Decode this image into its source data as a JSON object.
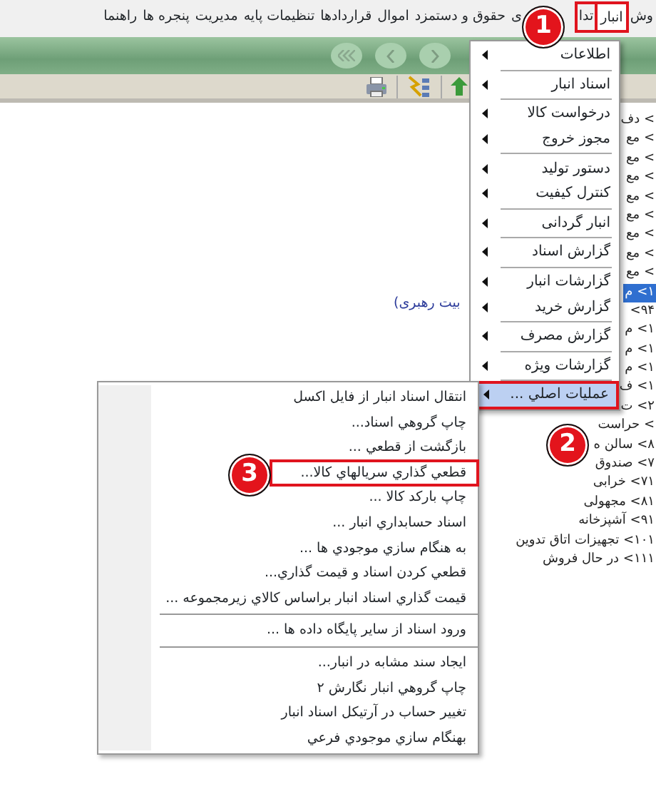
{
  "menu_bar": [
    {
      "label": "وش",
      "selected": false,
      "boxed": false
    },
    {
      "label": "انبار",
      "selected": true,
      "boxed": true
    },
    {
      "label": "تدا",
      "selected": false,
      "boxed": true
    },
    {
      "label": "ی",
      "selected": false,
      "boxed": false
    },
    {
      "label": "حقوق و دستمزد",
      "selected": false,
      "boxed": false
    },
    {
      "label": "اموال",
      "selected": false,
      "boxed": false
    },
    {
      "label": "قراردادها",
      "selected": false,
      "boxed": false
    },
    {
      "label": "تنظیمات پایه",
      "selected": false,
      "boxed": false
    },
    {
      "label": "مدیریت",
      "selected": false,
      "boxed": false
    },
    {
      "label": "پنجره ها",
      "selected": false,
      "boxed": false
    },
    {
      "label": "راهنما",
      "selected": false,
      "boxed": false
    }
  ],
  "tree": [
    {
      "label": "> دف",
      "selected": false
    },
    {
      "label": "> مع",
      "selected": false
    },
    {
      "label": "> مع",
      "selected": false
    },
    {
      "label": "> مع",
      "selected": false
    },
    {
      "label": "> مع",
      "selected": false
    },
    {
      "label": "> مع",
      "selected": false
    },
    {
      "label": "> مع",
      "selected": false
    },
    {
      "label": "> مع",
      "selected": false
    },
    {
      "label": "> مع",
      "selected": false
    },
    {
      "label": "۱> م",
      "selected": true
    },
    {
      "label": "۹۴>",
      "selected": false
    },
    {
      "label": "۱> م",
      "selected": false
    },
    {
      "label": "۱> م",
      "selected": false
    },
    {
      "label": "۱> م",
      "selected": false
    },
    {
      "label": "۱> ف",
      "selected": false
    },
    {
      "label": "۲> ت",
      "selected": false
    },
    {
      "label": "> حراست",
      "selected": false
    },
    {
      "label": "۸> سالن ه",
      "selected": false
    },
    {
      "label": "۷> صندوق",
      "selected": false
    },
    {
      "label": "۷۱> خرابی",
      "selected": false
    },
    {
      "label": "۸۱> مجهولی",
      "selected": false
    },
    {
      "label": "۹۱> آشپزخانه",
      "selected": false
    },
    {
      "label": "۱۰۱> تجهیزات اتاق تدوین",
      "selected": false
    },
    {
      "label": "۱۱۱> در حال فروش",
      "selected": false
    }
  ],
  "link_text": "بیت رهبری)",
  "menu": [
    [
      {
        "label": "اطلاعات",
        "selected": false,
        "boxed": false
      }
    ],
    [
      {
        "label": "اسناد انبار",
        "selected": false,
        "boxed": false
      }
    ],
    [
      {
        "label": "درخواست کالا",
        "selected": false,
        "boxed": false
      },
      {
        "label": "مجوز خروج",
        "selected": false,
        "boxed": false
      }
    ],
    [
      {
        "label": "دستور تولید",
        "selected": false,
        "boxed": false
      },
      {
        "label": "کنترل کیفیت",
        "selected": false,
        "boxed": false
      }
    ],
    [
      {
        "label": "انبار گردانی",
        "selected": false,
        "boxed": false
      }
    ],
    [
      {
        "label": "گزارش اسناد",
        "selected": false,
        "boxed": false
      }
    ],
    [
      {
        "label": "گزارشات انبار",
        "selected": false,
        "boxed": false
      },
      {
        "label": "گزارش خرید",
        "selected": false,
        "boxed": false
      }
    ],
    [
      {
        "label": "گزارش مصرف",
        "selected": false,
        "boxed": false
      }
    ],
    [
      {
        "label": "گزارشات ویژه",
        "selected": false,
        "boxed": false
      }
    ],
    [
      {
        "label": "عملیات اصلي ...",
        "selected": true,
        "boxed": true
      }
    ]
  ],
  "submenu": [
    [
      {
        "label": "انتقال اسناد انبار از فايل اكسل",
        "boxed": false
      },
      {
        "label": "چاپ گروهي اسناد...",
        "boxed": false
      },
      {
        "label": "بازگشت از قطعي ...",
        "boxed": false
      },
      {
        "label": "قطعي گذاري سريالهاي كالا...",
        "boxed": true
      },
      {
        "label": "چاپ باركد كالا ...",
        "boxed": false
      },
      {
        "label": "اسناد حسابداري انبار ...",
        "boxed": false
      },
      {
        "label": "به هنگام سازي موجودي ها ...",
        "boxed": false
      },
      {
        "label": "قطعي كردن اسناد و قيمت گذاري...",
        "boxed": false
      },
      {
        "label": "قيمت گذاري اسناد انبار براساس كالاي زيرمجموعه ...",
        "boxed": false
      }
    ],
    [
      {
        "label": "ورود اسناد از ساير پايگاه داده ها ...",
        "boxed": false
      }
    ],
    [
      {
        "label": "ايجاد سند مشابه در انبار...",
        "boxed": false
      },
      {
        "label": "چاپ گروهي انبار نگارش ۲",
        "boxed": false
      },
      {
        "label": "تغيير حساب در آرتيكل اسناد انبار",
        "boxed": false
      },
      {
        "label": "بهنگام سازي موجودي فرعي",
        "boxed": false
      }
    ]
  ],
  "callouts": [
    "1",
    "2",
    "3"
  ]
}
